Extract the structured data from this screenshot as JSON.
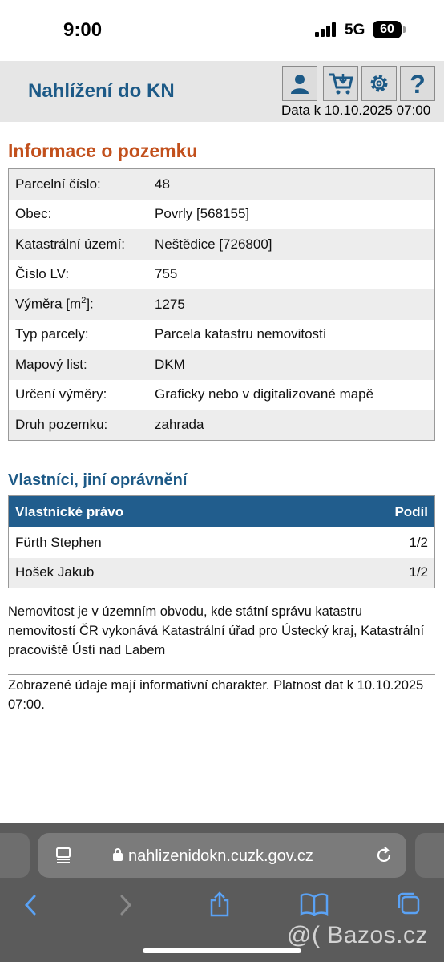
{
  "status_bar": {
    "time": "9:00",
    "network": "5G",
    "battery": "60"
  },
  "header": {
    "title": "Nahlížení do KN",
    "data_date": "Data k 10.10.2025 07:00",
    "icons": [
      "user-icon",
      "cart-icon",
      "gear-icon",
      "help-icon"
    ]
  },
  "parcel_section": {
    "heading": "Informace o pozemku",
    "rows": [
      {
        "label": "Parcelní číslo:",
        "value": "48"
      },
      {
        "label": "Obec:",
        "value": "Povrly [568155]"
      },
      {
        "label": "Katastrální území:",
        "value": "Neštědice [726800]"
      },
      {
        "label": "Číslo LV:",
        "value": "755"
      },
      {
        "label": "Výměra [m",
        "label_sup": "2",
        "label_tail": "]:",
        "value": "1275"
      },
      {
        "label": "Typ parcely:",
        "value": "Parcela katastru nemovitostí"
      },
      {
        "label": "Mapový list:",
        "value": "DKM"
      },
      {
        "label": "Určení výměry:",
        "value": "Graficky nebo v digitalizované mapě"
      },
      {
        "label": "Druh pozemku:",
        "value": "zahrada"
      }
    ]
  },
  "owners_section": {
    "heading": "Vlastníci, jiní oprávnění",
    "col_right": "Vlastnické právo",
    "col_share": "Podíl",
    "rows": [
      {
        "name": "Fürth Stephen",
        "share": "1/2"
      },
      {
        "name": "Hošek Jakub",
        "share": "1/2"
      }
    ]
  },
  "note": "Nemovitost je v územním obvodu, kde státní správu katastru nemovitostí ČR vykonává Katastrální úřad pro Ústecký kraj, Katastrální pracoviště Ústí nad Labem",
  "footer_note": "Zobrazené údaje mají informativní charakter. Platnost dat k 10.10.2025 07:00.",
  "browser": {
    "url": "nahlizenidokn.cuzk.gov.cz"
  },
  "watermark": "@( Bazos.cz",
  "colors": {
    "title_blue": "#1d5a87",
    "heading_orange": "#c2501c",
    "table_head_blue": "#215d8d"
  }
}
